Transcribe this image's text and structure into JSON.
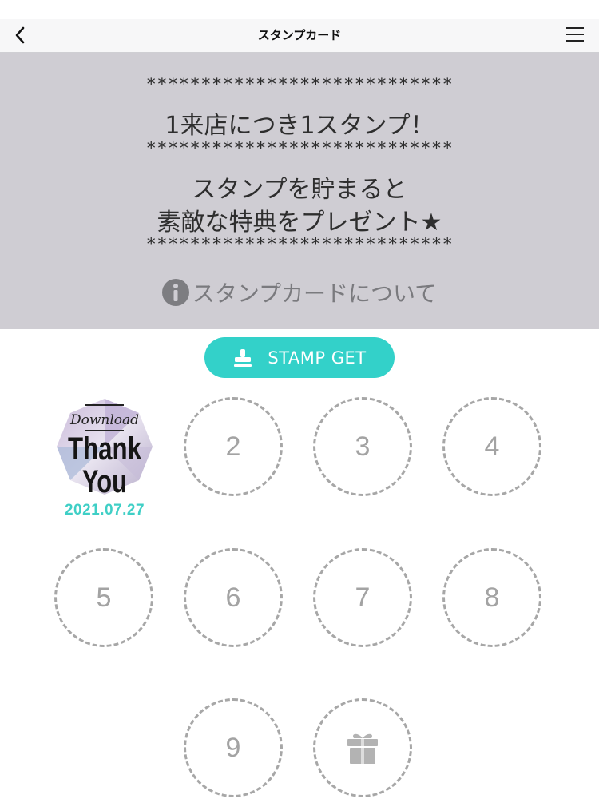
{
  "nav": {
    "title": "スタンプカード",
    "back_icon": "chevron-left-icon",
    "menu_icon": "hamburger-menu-icon"
  },
  "info": {
    "stars": "****************************",
    "line1": "1来店につき1スタンプ！",
    "line2": "スタンプを貯まると",
    "line3": "素敵な特典をプレゼント★",
    "about_label": "スタンプカードについて",
    "about_icon": "info-icon"
  },
  "stamp_get": {
    "label": "STAMP GET",
    "icon": "stamp-icon"
  },
  "stamp": {
    "top_text": "Download",
    "main_line1": "Thank",
    "main_line2": "You",
    "date": "2021.07.27"
  },
  "slots": [
    "2",
    "3",
    "4",
    "5",
    "6",
    "7",
    "8",
    "9"
  ],
  "reward_icon": "gift-icon",
  "colors": {
    "accent": "#33d1c9",
    "panel": "#cfcdd3",
    "slot_border": "#a7a7a7"
  }
}
